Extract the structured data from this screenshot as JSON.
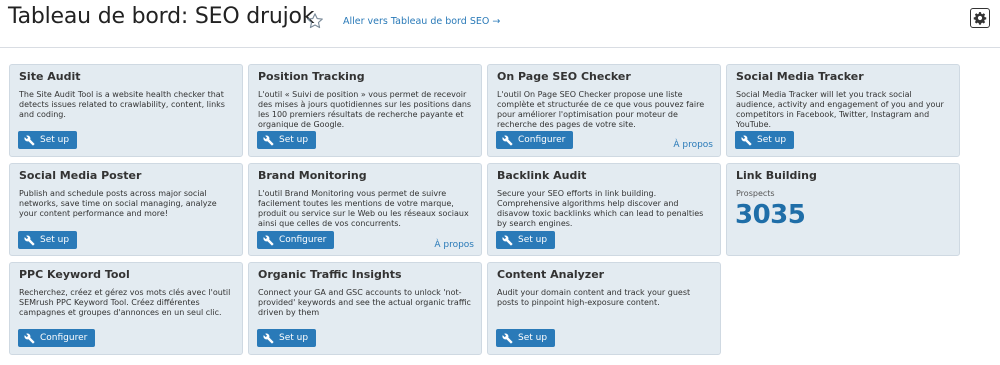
{
  "header": {
    "title": "Tableau de bord: SEO drujok",
    "link": "Aller vers Tableau de bord SEO →",
    "icons": {
      "favorite": "star-icon",
      "settings": "gear-icon"
    }
  },
  "colors": {
    "card_bg": "#e3ebf1",
    "button": "#2a7ab8",
    "link": "#2a7ab8",
    "metric": "#1f6ea8"
  },
  "cards": [
    {
      "title": "Site Audit",
      "description": "The Site Audit Tool is a website health checker that detects issues related to crawlability, content, links and coding.",
      "button": "Set up"
    },
    {
      "title": "Position Tracking",
      "description": "L'outil « Suivi de position » vous permet de recevoir des mises à jours quotidiennes sur les positions dans les 100 premiers résultats de recherche payante et organique de Google.",
      "button": "Set up"
    },
    {
      "title": "On Page SEO Checker",
      "description": "L'outil On Page SEO Checker propose une liste complète et structurée de ce que vous pouvez faire pour améliorer l'optimisation pour moteur de recherche des pages de votre site.",
      "button": "Configurer",
      "link": "À propos"
    },
    {
      "title": "Social Media Tracker",
      "description": "Social Media Tracker will let you track social audience, activity and engagement of you and your competitors in Facebook, Twitter, Instagram and YouTube.",
      "button": "Set up"
    },
    {
      "title": "Social Media Poster",
      "description": "Publish and schedule posts across major social networks, save time on social managing, analyze your content performance and more!",
      "button": "Set up"
    },
    {
      "title": "Brand Monitoring",
      "description": "L'outil Brand Monitoring vous permet de suivre facilement toutes les mentions de votre marque, produit ou service sur le Web ou les réseaux sociaux ainsi que celles de vos concurrents.",
      "button": "Configurer",
      "link": "À propos"
    },
    {
      "title": "Backlink Audit",
      "description": "Secure your SEO efforts in link building. Comprehensive algorithms help discover and disavow toxic backlinks which can lead to penalties by search engines.",
      "button": "Set up"
    },
    {
      "title": "Link Building",
      "metric_label": "Prospects",
      "metric_value": "3035"
    },
    {
      "title": "PPC Keyword Tool",
      "description": "Recherchez, créez et gérez vos mots clés avec l'outil SEMrush PPC Keyword Tool. Créez différentes campagnes et groupes d'annonces en un seul clic.",
      "button": "Configurer"
    },
    {
      "title": "Organic Traffic Insights",
      "description": "Connect your GA and GSC accounts to unlock 'not-provided' keywords and see the actual organic traffic driven by them",
      "button": "Set up"
    },
    {
      "title": "Content Analyzer",
      "description": "Audit your domain content and track your guest posts to pinpoint high-exposure content.",
      "button": "Set up"
    }
  ]
}
